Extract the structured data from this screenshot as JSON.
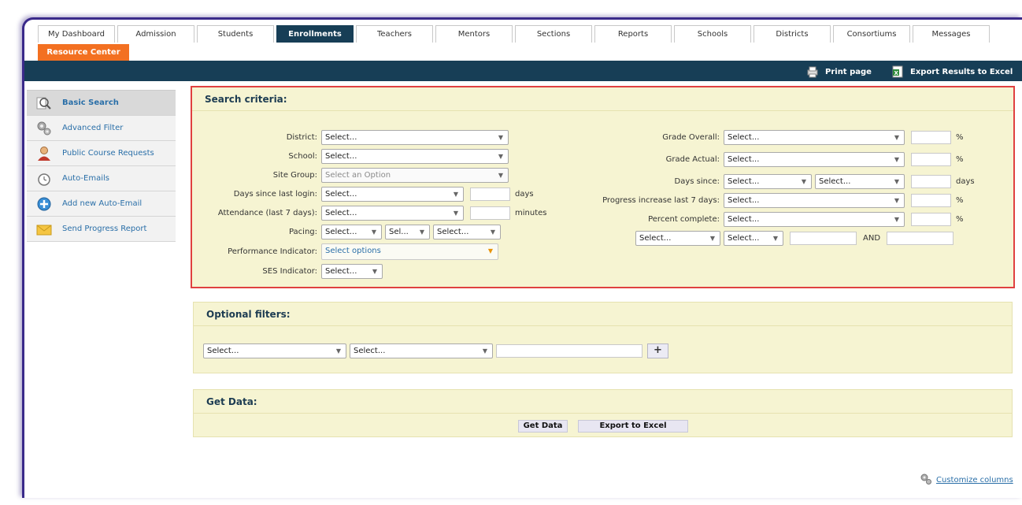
{
  "tabs": [
    "My Dashboard",
    "Admission",
    "Students",
    "Enrollments",
    "Teachers",
    "Mentors",
    "Sections",
    "Reports",
    "Schools",
    "Districts",
    "Consortiums",
    "Messages"
  ],
  "active_tab": "Enrollments",
  "resource_center": "Resource Center",
  "toolbar": {
    "print": "Print page",
    "export": "Export Results to Excel"
  },
  "sidebar": [
    {
      "label": "Basic Search",
      "icon": "magnifier-icon"
    },
    {
      "label": "Advanced Filter",
      "icon": "gears-icon"
    },
    {
      "label": "Public Course Requests",
      "icon": "person-icon"
    },
    {
      "label": "Auto-Emails",
      "icon": "clock-icon"
    },
    {
      "label": "Add new Auto-Email",
      "icon": "add-circle-icon"
    },
    {
      "label": "Send Progress Report",
      "icon": "envelope-icon"
    }
  ],
  "search": {
    "title": "Search criteria:",
    "district_label": "District:",
    "district_value": "Select...",
    "school_label": "School:",
    "school_value": "Select...",
    "site_group_label": "Site Group:",
    "site_group_value": "Select an Option",
    "days_login_label": "Days since last login:",
    "days_login_value": "Select...",
    "days_unit": "days",
    "attendance_label": "Attendance (last 7 days):",
    "attendance_value": "Select...",
    "minutes_unit": "minutes",
    "pacing_label": "Pacing:",
    "pacing_values": [
      "Select...",
      "Sel...",
      "Select..."
    ],
    "perf_label": "Performance Indicator:",
    "perf_value": "Select options",
    "ses_label": "SES Indicator:",
    "ses_value": "Select...",
    "grade_overall_label": "Grade Overall:",
    "grade_overall_value": "Select...",
    "grade_actual_label": "Grade Actual:",
    "grade_actual_value": "Select...",
    "days_since_label": "Days since:",
    "days_since_values": [
      "Select...",
      "Select..."
    ],
    "progress_label": "Progress increase last 7 days:",
    "progress_value": "Select...",
    "percent_label": "Percent complete:",
    "percent_value": "Select...",
    "extra_values": [
      "Select...",
      "Select..."
    ],
    "percent_unit": "%",
    "and_label": "AND"
  },
  "optional": {
    "title": "Optional filters:",
    "sel1": "Select...",
    "sel2": "Select...",
    "add": "+"
  },
  "getdata": {
    "title": "Get Data:",
    "get_btn": "Get Data",
    "export_btn": "Export to Excel"
  },
  "customize": "Customize columns"
}
